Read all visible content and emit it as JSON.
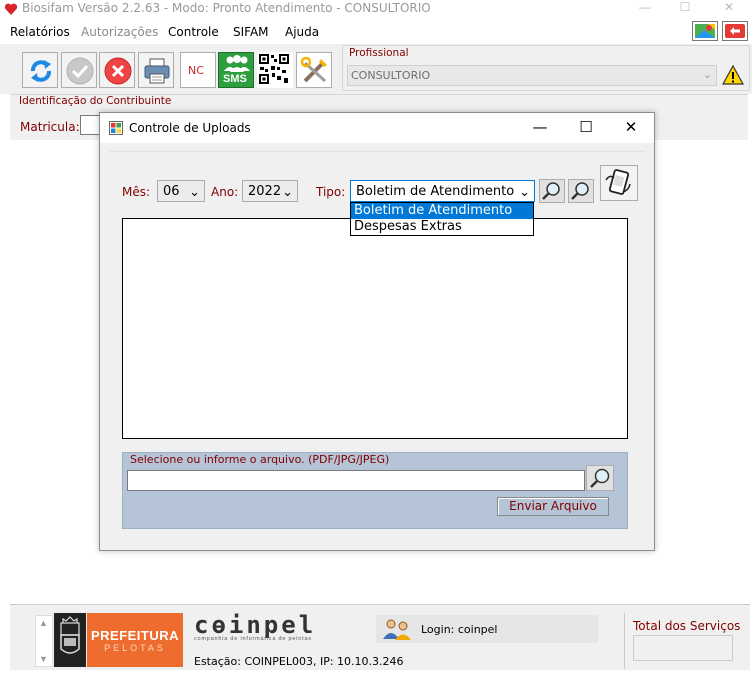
{
  "app": {
    "title": "Biosifam Versão 2.2.63 - Modo: Pronto Atendimento - CONSULTORIO",
    "minimize_glyph": "—",
    "maximize_glyph": "☐",
    "close_glyph": "✕"
  },
  "menu": {
    "items": [
      {
        "label": "Relatórios",
        "enabled": true
      },
      {
        "label": "Autorizações",
        "enabled": false
      },
      {
        "label": "Controle",
        "enabled": true
      },
      {
        "label": "SIFAM",
        "enabled": true
      },
      {
        "label": "Ajuda",
        "enabled": true
      }
    ]
  },
  "toolbar": {
    "nc_label": "NC",
    "sms_label": "SMS"
  },
  "profissional": {
    "legend": "Profissional",
    "value": "CONSULTORIO"
  },
  "identificacao": {
    "legend": "Identificação do Contribuinte",
    "matricula_label": "Matricula:"
  },
  "dialog": {
    "title": "Controle de Uploads",
    "mes_label": "Mês:",
    "mes_value": "06",
    "ano_label": "Ano:",
    "ano_value": "2022",
    "tipo_label": "Tipo:",
    "tipo_value": "Boletim de Atendimento",
    "tipo_options": [
      "Boletim de Atendimento",
      "Despesas Extras"
    ],
    "tipo_selected_index": 0,
    "upload_legend": "Selecione ou informe o arquivo. (PDF/JPG/JPEG)",
    "send_label": "Enviar Arquivo"
  },
  "status": {
    "prefeitura_l1": "PREFEITURA",
    "prefeitura_l2": "PELOTAS",
    "coinpel": "cɵinpel",
    "coinpel_sub": "companhia de informática de pelotas",
    "estacao": "Estação: COINPEL003, IP: 10.10.3.246",
    "login": "Login: coinpel",
    "total_label": "Total dos Serviços"
  },
  "colors": {
    "label_maroon": "#800000",
    "accent_blue": "#0078d7",
    "upload_panel": "#b5c4d6",
    "prefeitura_orange": "#ef6c2f"
  }
}
